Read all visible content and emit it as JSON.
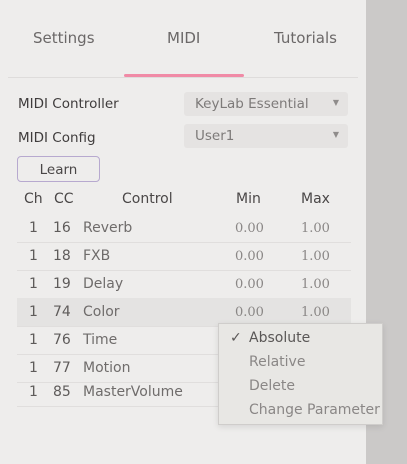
{
  "tabs": {
    "items": [
      {
        "label": "Settings"
      },
      {
        "label": "MIDI"
      },
      {
        "label": "Tutorials"
      }
    ],
    "active": "MIDI",
    "accent_color": "#f08aa6"
  },
  "midi_controller": {
    "label": "MIDI Controller",
    "value": "KeyLab Essential"
  },
  "midi_config": {
    "label": "MIDI Config",
    "value": "User1"
  },
  "learn_button": {
    "label": "Learn"
  },
  "table": {
    "headers": {
      "ch": "Ch",
      "cc": "CC",
      "control": "Control",
      "min": "Min",
      "max": "Max"
    },
    "rows": [
      {
        "ch": "1",
        "cc": "16",
        "control": "Reverb",
        "min": "0.00",
        "max": "1.00"
      },
      {
        "ch": "1",
        "cc": "18",
        "control": "FXB",
        "min": "0.00",
        "max": "1.00"
      },
      {
        "ch": "1",
        "cc": "19",
        "control": "Delay",
        "min": "0.00",
        "max": "1.00"
      },
      {
        "ch": "1",
        "cc": "74",
        "control": "Color",
        "min": "0.00",
        "max": "1.00",
        "selected": true
      },
      {
        "ch": "1",
        "cc": "76",
        "control": "Time",
        "min": "",
        "max": ""
      },
      {
        "ch": "1",
        "cc": "77",
        "control": "Motion",
        "min": "",
        "max": ""
      },
      {
        "ch": "1",
        "cc": "85",
        "control": "MasterVolume",
        "min": "",
        "max": ""
      }
    ]
  },
  "context_menu": {
    "check_mark": "✓",
    "items": [
      {
        "label": "Absolute",
        "checked": true
      },
      {
        "label": "Relative"
      },
      {
        "label": "Delete"
      },
      {
        "label": "Change Parameter"
      }
    ]
  }
}
